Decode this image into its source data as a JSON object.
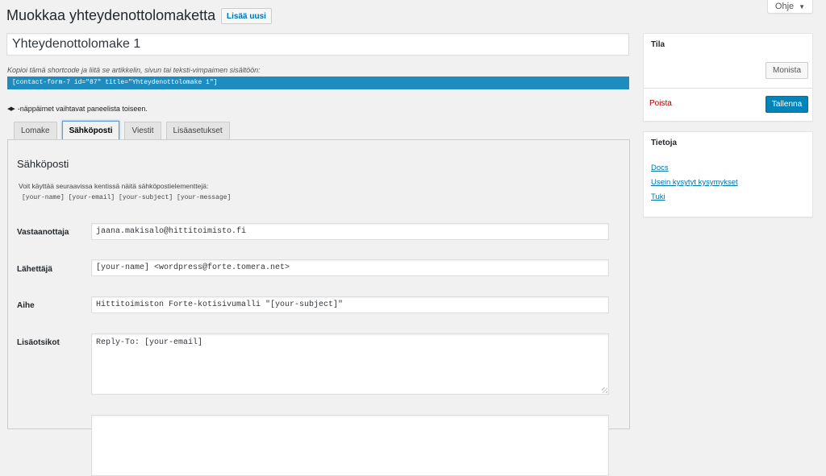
{
  "help": {
    "label": "Ohje"
  },
  "page_title": "Muokkaa yhteydenottolomaketta",
  "add_new_label": "Lisää uusi",
  "form_title": "Yhteydenottolomake 1",
  "shortcode": {
    "label": "Kopioi tämä shortcode ja liitä se artikkelin, sivun tai teksti-vimpaimen sisältöön:",
    "value": "[contact-form-7 id=\"87\" title=\"Yhteydenottolomake 1\"]"
  },
  "keys_hint": "-näppäimet vaihtavat paneelista toiseen.",
  "tabs": [
    {
      "label": "Lomake",
      "active": false
    },
    {
      "label": "Sähköposti",
      "active": true
    },
    {
      "label": "Viestit",
      "active": false
    },
    {
      "label": "Lisäasetukset",
      "active": false
    }
  ],
  "mail_panel": {
    "title": "Sähköposti",
    "description": "Voit käyttää seuraavissa kentissä näitä sähköpostielementtejä:",
    "tags": "[your-name] [your-email] [your-subject] [your-message]",
    "fields": {
      "recipient": {
        "label": "Vastaanottaja",
        "value": "jaana.makisalo@hittitoimisto.fi"
      },
      "sender": {
        "label": "Lähettäjä",
        "value": "[your-name] <wordpress@forte.tomera.net>"
      },
      "subject": {
        "label": "Aihe",
        "value": "Hittitoimiston Forte-kotisivumalli \"[your-subject]\""
      },
      "headers": {
        "label": "Lisäotsikot",
        "value": "Reply-To: [your-email]"
      },
      "body": {
        "value": ""
      }
    }
  },
  "status_box": {
    "title": "Tila",
    "duplicate_label": "Monista",
    "delete_label": "Poista",
    "save_label": "Tallenna"
  },
  "info_box": {
    "title": "Tietoja",
    "links": [
      "Docs",
      "Usein kysytyt kysymykset",
      "Tuki"
    ]
  },
  "colors": {
    "primary_button": "#0085ba",
    "shortcode_bg": "#1e8cbe",
    "delete_link": "#a00000",
    "link": "#0073aa"
  }
}
